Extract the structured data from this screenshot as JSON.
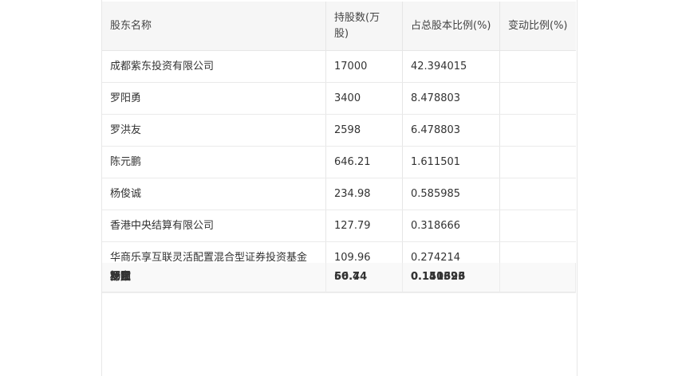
{
  "table": {
    "headers": [
      "股东名称",
      "持股数(万股)",
      "占总股本比例(%)",
      "变动比例(%)"
    ],
    "rows": [
      {
        "name": "成都紫东投资有限公司",
        "shares": "17000",
        "ratio": "42.394015",
        "change": ""
      },
      {
        "name": "罗阳勇",
        "shares": "3400",
        "ratio": "8.478803",
        "change": ""
      },
      {
        "name": "罗洪友",
        "shares": "2598",
        "ratio": "6.478803",
        "change": ""
      },
      {
        "name": "陈元鹏",
        "shares": "646.21",
        "ratio": "1.611501",
        "change": ""
      },
      {
        "name": "杨俊诚",
        "shares": "234.98",
        "ratio": "0.585985",
        "change": ""
      },
      {
        "name": "香港中央结算有限公司",
        "shares": "127.79",
        "ratio": "0.318666",
        "change": ""
      },
      {
        "name": "华商乐享互联灵活配置混合型证券投资基金",
        "shares": "109.96",
        "ratio": "0.274214",
        "change": ""
      }
    ],
    "overlap_row": {
      "names": [
        "杨霆",
        "罗阳",
        "邓宝"
      ],
      "shares": [
        "56.74",
        "60.4"
      ],
      "ratios": [
        "0.141396",
        "0.150623"
      ]
    }
  }
}
